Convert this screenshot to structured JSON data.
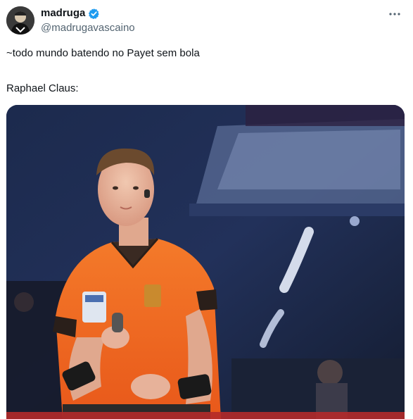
{
  "author": {
    "display_name": "madruga",
    "handle": "@madrugavascaino",
    "verified": true,
    "avatar_icon": "avatar-image"
  },
  "menu": {
    "icon": "more-options-icon",
    "label": "···"
  },
  "tweet": {
    "lines": [
      "~todo mundo batendo no Payet sem bola",
      "Raphael Claus:"
    ]
  },
  "media": {
    "kind": "video-still",
    "description_icon": "referee-photo"
  },
  "colors": {
    "verified": "#1d9bf0",
    "handle": "#536471",
    "text": "#0f1419",
    "referee_shirt": "#f26a1e"
  }
}
